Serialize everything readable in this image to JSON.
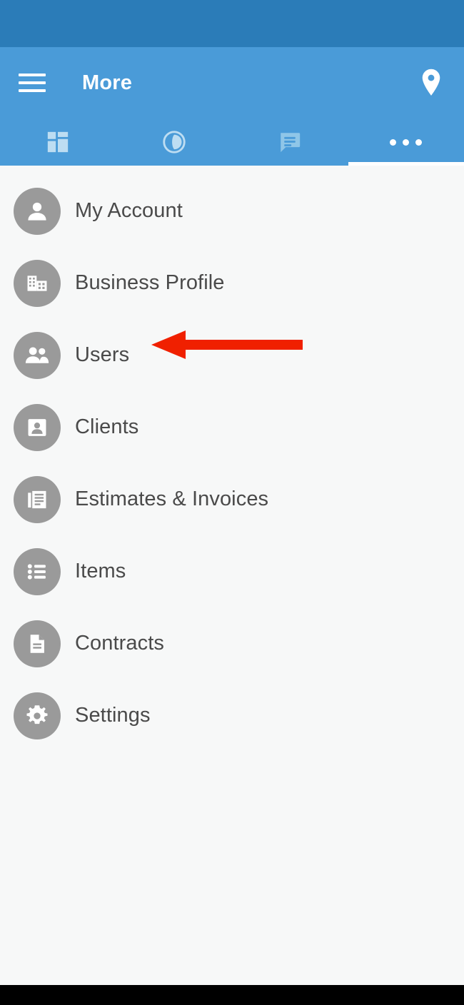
{
  "colors": {
    "status_bar": "#2b7cb8",
    "app_bar": "#4a9bd8",
    "content_bg": "#f7f8f8",
    "icon_circle": "#9a9a9a",
    "label_text": "#4a4a4a",
    "annotation_red": "#f02000",
    "bottom_nav": "#000000"
  },
  "app_bar": {
    "menu_icon": "hamburger-menu-icon",
    "title": "More",
    "action_icon": "location-pin-icon"
  },
  "tabs": [
    {
      "icon": "dashboard-grid-icon",
      "label": "",
      "active": false
    },
    {
      "icon": "timer-clock-icon",
      "label": "",
      "active": false
    },
    {
      "icon": "chat-bubble-icon",
      "label": "",
      "active": false
    },
    {
      "icon": "more-horizontal-icon",
      "label": "",
      "active": true
    }
  ],
  "menu": {
    "items": [
      {
        "label": "My Account",
        "icon": "person-icon"
      },
      {
        "label": "Business Profile",
        "icon": "building-icon"
      },
      {
        "label": "Users",
        "icon": "people-group-icon"
      },
      {
        "label": "Clients",
        "icon": "contact-card-icon"
      },
      {
        "label": "Estimates & Invoices",
        "icon": "documents-icon"
      },
      {
        "label": "Items",
        "icon": "bulleted-list-icon"
      },
      {
        "label": "Contracts",
        "icon": "document-file-icon"
      },
      {
        "label": "Settings",
        "icon": "gear-icon"
      }
    ]
  },
  "annotation": {
    "type": "arrow-left",
    "points_at": "Users",
    "color": "#f02000"
  }
}
